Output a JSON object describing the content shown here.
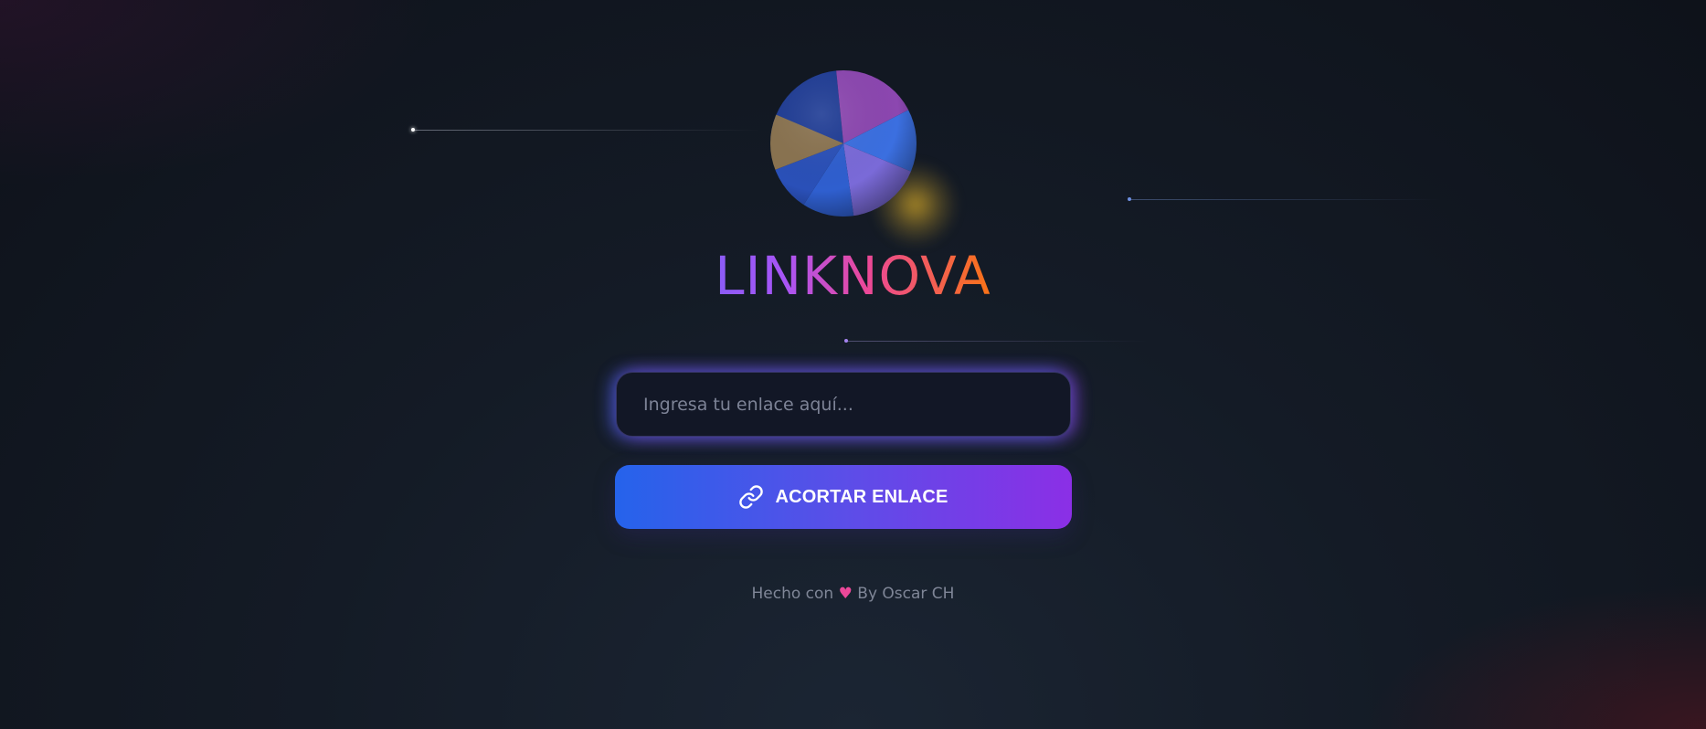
{
  "brand": {
    "name": "LINKNOVA",
    "gradient_colors": [
      "#8b5cf6",
      "#a855f7",
      "#ec4899",
      "#f97316"
    ]
  },
  "logo": {
    "icon": "colorful-sphere-logo"
  },
  "form": {
    "url_placeholder": "Ingresa tu enlace aquí...",
    "url_value": "",
    "submit_label": "ACORTAR ENLACE",
    "submit_icon": "link-icon",
    "button_gradient": [
      "#2563eb",
      "#8b2fe6"
    ]
  },
  "footer": {
    "prefix": "Hecho con",
    "heart": "♥",
    "suffix": "By Oscar CH",
    "heart_color": "#ec4899"
  }
}
